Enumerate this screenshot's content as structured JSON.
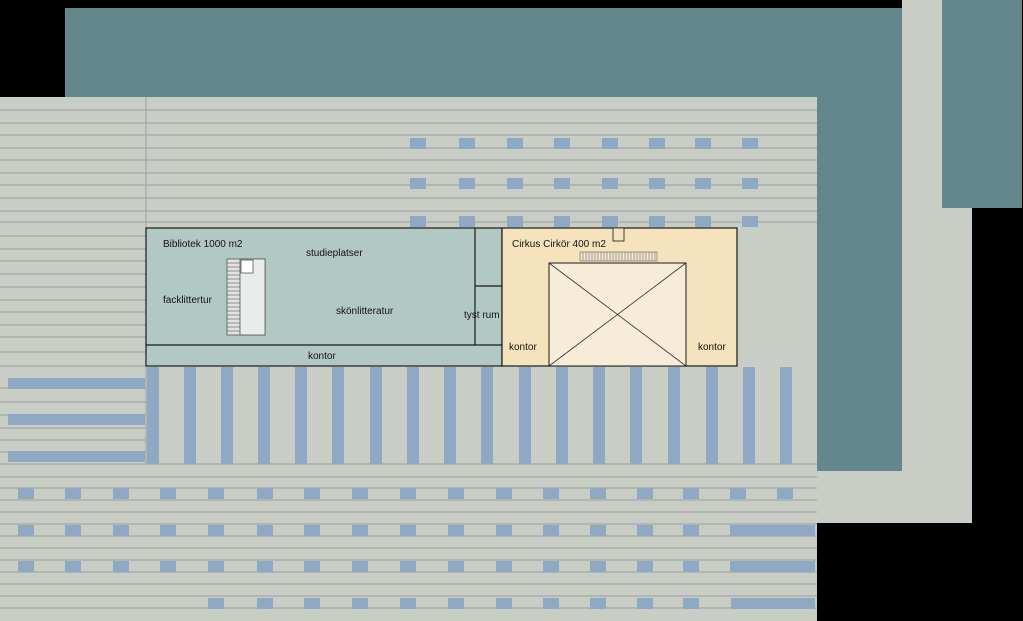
{
  "colors": {
    "background": "#000000",
    "floor": "#c8cdc6",
    "roof": "#64878d",
    "window": "#8fa9c4",
    "library": "#b2c8c5",
    "circus": "#f4e3bd",
    "stage": "#f6ecd8",
    "line": "#1a1a1a"
  },
  "library": {
    "title": "Bibliotek 1000 m2",
    "study": "studieplatser",
    "nonfiction": "facklittertur",
    "fiction": "skönlitteratur",
    "quiet": "tyst rum",
    "office": "kontor"
  },
  "circus": {
    "title": "Cirkus Cirkör 400 m2",
    "office_left": "kontor",
    "office_right": "kontor"
  }
}
